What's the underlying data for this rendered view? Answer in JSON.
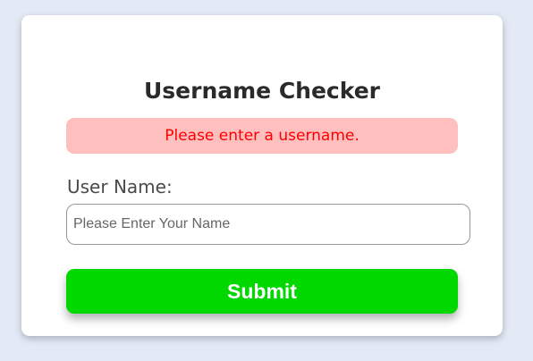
{
  "form": {
    "title": "Username Checker",
    "error_message": "Please enter a username.",
    "label": "User Name:",
    "input_value": "",
    "input_placeholder": "Please Enter Your Name",
    "submit_label": "Submit"
  },
  "colors": {
    "error_bg": "#ffbfbf",
    "error_text": "#ff0000",
    "submit_bg": "#00d800"
  }
}
